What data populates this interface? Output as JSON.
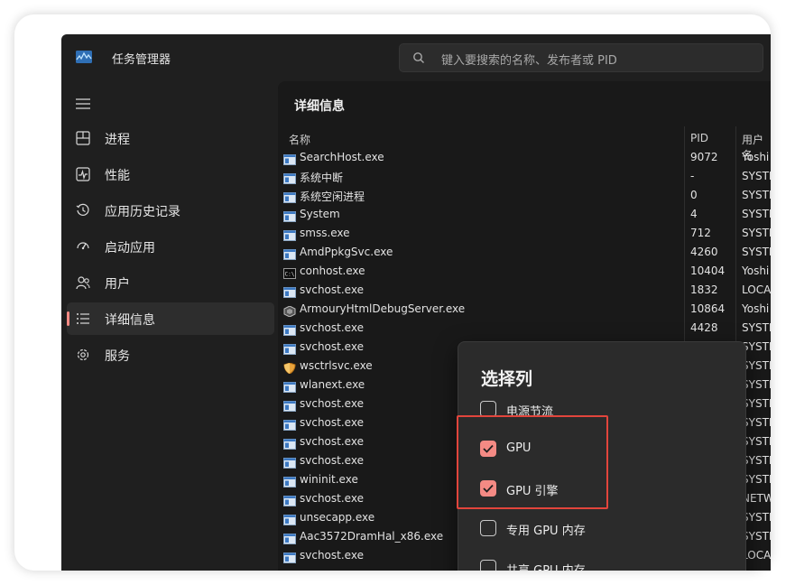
{
  "app": {
    "title": "任务管理器"
  },
  "search": {
    "placeholder": "键入要搜索的名称、发布者或 PID"
  },
  "nav": {
    "items": [
      {
        "label": "进程",
        "icon": "processes-icon"
      },
      {
        "label": "性能",
        "icon": "performance-icon"
      },
      {
        "label": "应用历史记录",
        "icon": "history-icon"
      },
      {
        "label": "启动应用",
        "icon": "startup-icon"
      },
      {
        "label": "用户",
        "icon": "users-icon"
      },
      {
        "label": "详细信息",
        "icon": "details-icon",
        "active": true
      },
      {
        "label": "服务",
        "icon": "services-icon"
      }
    ]
  },
  "page": {
    "title": "详细信息"
  },
  "table": {
    "headers": {
      "name": "名称",
      "pid": "PID",
      "user": "用户名"
    },
    "rows": [
      {
        "name": "SearchHost.exe",
        "pid": "9072",
        "user": "Yoshi",
        "icon": "app"
      },
      {
        "name": "系统中断",
        "pid": "-",
        "user": "SYSTE",
        "icon": "app"
      },
      {
        "name": "系统空闲进程",
        "pid": "0",
        "user": "SYSTE",
        "icon": "app"
      },
      {
        "name": "System",
        "pid": "4",
        "user": "SYSTE",
        "icon": "app"
      },
      {
        "name": "smss.exe",
        "pid": "712",
        "user": "SYSTE",
        "icon": "app"
      },
      {
        "name": "AmdPpkgSvc.exe",
        "pid": "4260",
        "user": "SYSTE",
        "icon": "app"
      },
      {
        "name": "conhost.exe",
        "pid": "10404",
        "user": "Yoshi",
        "icon": "console"
      },
      {
        "name": "svchost.exe",
        "pid": "1832",
        "user": "LOCA",
        "icon": "app"
      },
      {
        "name": "ArmouryHtmlDebugServer.exe",
        "pid": "10864",
        "user": "Yoshi",
        "icon": "hex"
      },
      {
        "name": "svchost.exe",
        "pid": "4428",
        "user": "SYSTE",
        "icon": "app"
      },
      {
        "name": "svchost.exe",
        "pid": "",
        "user": "SYSTE",
        "icon": "app"
      },
      {
        "name": "wsctrlsvc.exe",
        "pid": "",
        "user": "SYSTE",
        "icon": "shield"
      },
      {
        "name": "wlanext.exe",
        "pid": "",
        "user": "SYSTE",
        "icon": "app"
      },
      {
        "name": "svchost.exe",
        "pid": "",
        "user": "SYSTE",
        "icon": "app"
      },
      {
        "name": "svchost.exe",
        "pid": "",
        "user": "SYSTE",
        "icon": "app"
      },
      {
        "name": "svchost.exe",
        "pid": "",
        "user": "SYSTE",
        "icon": "app"
      },
      {
        "name": "svchost.exe",
        "pid": "",
        "user": "SYSTE",
        "icon": "app"
      },
      {
        "name": "wininit.exe",
        "pid": "",
        "user": "SYSTE",
        "icon": "app"
      },
      {
        "name": "svchost.exe",
        "pid": "",
        "user": "NETW",
        "icon": "app"
      },
      {
        "name": "unsecapp.exe",
        "pid": "",
        "user": "SYSTE",
        "icon": "app"
      },
      {
        "name": "Aac3572DramHal_x86.exe",
        "pid": "",
        "user": "SYSTE",
        "icon": "app"
      },
      {
        "name": "svchost.exe",
        "pid": "",
        "user": "LOCA",
        "icon": "app"
      }
    ]
  },
  "popup": {
    "title": "选择列",
    "options": [
      {
        "label": "电源节流",
        "checked": false
      },
      {
        "label": "GPU",
        "checked": true
      },
      {
        "label": "GPU 引擎",
        "checked": true
      },
      {
        "label": "专用 GPU 内存",
        "checked": false
      },
      {
        "label": "共享 GPU 内存",
        "checked": false
      }
    ]
  },
  "colors": {
    "accent": "#f48a84",
    "highlight": "#e2453c",
    "background": "#1f1f1f"
  }
}
